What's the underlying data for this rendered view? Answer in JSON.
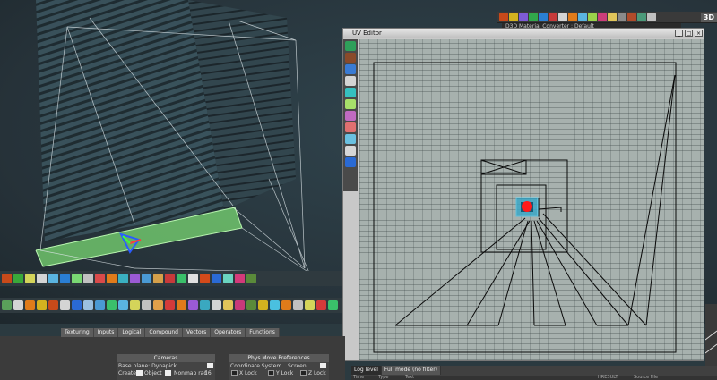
{
  "top_toolbar": {
    "view_mode": "3D",
    "material_bar": "D3D Material Converter : Default"
  },
  "uv_editor": {
    "title": "UV Editor"
  },
  "tabs": [
    "Texturing",
    "Inputs",
    "Logical",
    "Compound",
    "Vectors",
    "Operators",
    "Functions"
  ],
  "cameras_panel": {
    "title": "Cameras",
    "row1": "Base plane: Dynapick",
    "create": "Create",
    "object": "Object",
    "nonmap_label": "Nonmap rad",
    "nonmap_value": "16"
  },
  "phys_panel": {
    "title": "Phys Move Preferences",
    "coord_label": "Coordinate System",
    "coord_value": "Screen",
    "x_lock": "X Lock",
    "y_lock": "Y Lock",
    "z_lock": "Z Lock"
  },
  "log_panel": {
    "tabs": [
      "Log level",
      "Full mode (no filter)"
    ],
    "columns": [
      "Time",
      "Type",
      "Text",
      "HRESULT",
      "Source File"
    ]
  },
  "colors": {
    "ui_dark": "#3b3b3b",
    "uv_bg": "#a7b1ae",
    "accent_green": "#7ad873",
    "uv_red": "#ff1a1a",
    "uv_cyan": "#3ba7c6"
  }
}
